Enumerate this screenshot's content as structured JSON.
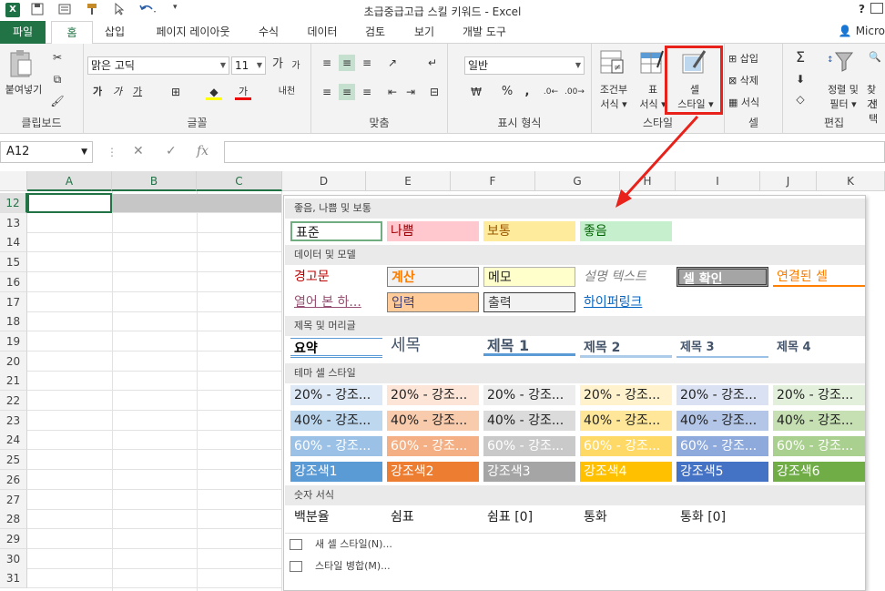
{
  "window": {
    "title": "초급중급고급 스킬 키워드 - Excel",
    "help": "?"
  },
  "quick_access": {
    "app_icon": "X",
    "save_icon": "save-icon",
    "undo_icon": "undo-icon"
  },
  "tabs": {
    "file": "파일",
    "home": "홈",
    "insert": "삽입",
    "layout": "페이지 레이아웃",
    "formulas": "수식",
    "data": "데이터",
    "review": "검토",
    "view": "보기",
    "developer": "개발 도구",
    "account": "Micro"
  },
  "ribbon": {
    "clipboard": {
      "paste": "붙여넣기",
      "label": "클립보드"
    },
    "font": {
      "name": "맑은 고딕",
      "size": "11",
      "grow": "가",
      "shrink": "가",
      "bold": "가",
      "italic": "가",
      "underline": "가",
      "color_letter": "가",
      "phonetic": "내천",
      "label": "글꼴"
    },
    "alignment": {
      "label": "맞춤"
    },
    "number": {
      "format": "일반",
      "label": "표시 형식",
      "percent": "%",
      "comma": ","
    },
    "styles": {
      "conditional": [
        "조건부",
        "서식 ▾"
      ],
      "table": [
        "표",
        "서식 ▾"
      ],
      "cell_styles": [
        "셀",
        "스타일 ▾"
      ],
      "label": "스타일"
    },
    "cells": {
      "insert": "삽입",
      "delete": "삭제",
      "format": "서식",
      "label": "셀"
    },
    "editing": {
      "sort": [
        "정렬 및",
        "필터 ▾"
      ],
      "find": [
        "찾기",
        "선택"
      ],
      "label": "편집"
    }
  },
  "formula_bar": {
    "name_box": "A12",
    "cancel": "✕",
    "enter": "✓",
    "fx": "fx",
    "value": ""
  },
  "sheet": {
    "columns": [
      "A",
      "B",
      "C",
      "D",
      "E",
      "F",
      "G",
      "H",
      "I",
      "J",
      "K"
    ],
    "rows": [
      "12",
      "13",
      "14",
      "15",
      "16",
      "17",
      "18",
      "19",
      "20",
      "21",
      "22",
      "23",
      "24",
      "25",
      "26",
      "27",
      "28",
      "29",
      "30",
      "31"
    ]
  },
  "gallery": {
    "sections": {
      "good_bad": "좋음, 나쁨 및 보통",
      "data_model": "데이터 및 모델",
      "titles": "제목 및 머리글",
      "theme": "테마 셀 스타일",
      "number": "숫자 서식"
    },
    "good_bad": [
      "표준",
      "나쁨",
      "보통",
      "좋음"
    ],
    "data_model": [
      "경고문",
      "계산",
      "메모",
      "설명 텍스트",
      "셀 확인",
      "연결된 셀",
      "열어 본 하...",
      "입력",
      "출력",
      "하이퍼링크"
    ],
    "titles": [
      "요약",
      "세목",
      "제목 1",
      "제목 2",
      "제목 3",
      "제목 4"
    ],
    "theme": {
      "r20": [
        "20% - 강조...",
        "20% - 강조...",
        "20% - 강조...",
        "20% - 강조...",
        "20% - 강조...",
        "20% - 강조..."
      ],
      "r40": [
        "40% - 강조...",
        "40% - 강조...",
        "40% - 강조...",
        "40% - 강조...",
        "40% - 강조...",
        "40% - 강조..."
      ],
      "r60": [
        "60% - 강조...",
        "60% - 강조...",
        "60% - 강조...",
        "60% - 강조...",
        "60% - 강조...",
        "60% - 강조..."
      ],
      "accent": [
        "강조색1",
        "강조색2",
        "강조색3",
        "강조색4",
        "강조색5",
        "강조색6"
      ]
    },
    "number": [
      "백분율",
      "쉼표",
      "쉼표 [0]",
      "통화",
      "통화 [0]"
    ],
    "footer": {
      "new_style": "새 셀 스타일(N)...",
      "merge": "스타일 병합(M)..."
    }
  },
  "colors": {
    "accent": "#217346",
    "highlight": "#e8211b",
    "theme_20": [
      "#dde8f6",
      "#fce4d6",
      "#ededed",
      "#fff2cc",
      "#d9e1f2",
      "#e2efda"
    ],
    "theme_40": [
      "#bdd7ee",
      "#f8cbad",
      "#dbdbdb",
      "#ffe699",
      "#b4c6e7",
      "#c6e0b4"
    ],
    "theme_60": [
      "#9bc2e6",
      "#f4b084",
      "#c9c9c9",
      "#ffd966",
      "#8ea9db",
      "#a9d08e"
    ],
    "theme_accent": [
      "#5b9bd5",
      "#ed7d31",
      "#a5a5a5",
      "#ffc000",
      "#4472c4",
      "#70ad47"
    ]
  }
}
